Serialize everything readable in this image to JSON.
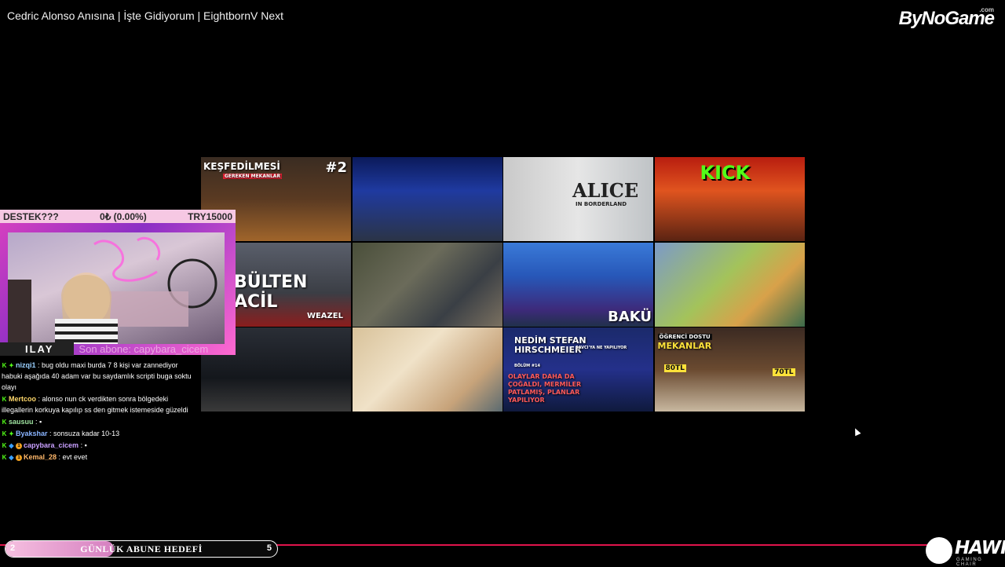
{
  "header": {
    "title": "Cedric Alonso Anısına | İşte Gidiyorum | EightbornV Next",
    "brand": "ByNoGame",
    "brand_sup": ".com"
  },
  "grid": {
    "thumbs": [
      {
        "caption": "KEŞFEDİLMESİ",
        "caption2": "#2",
        "subcap": "GEREKEN MEKANLAR"
      },
      {
        "caption": ""
      },
      {
        "caption": "ALICE",
        "subcap": "IN BORDERLAND"
      },
      {
        "caption": "KICK"
      },
      {
        "caption": "BÜLTEN ACİL",
        "subcap": "WEAZEL"
      },
      {
        "caption": ""
      },
      {
        "caption": "BAKÜ"
      },
      {
        "caption": ""
      },
      {
        "caption": ""
      },
      {
        "caption": ""
      },
      {
        "caption": "NEDİM STEFAN HIRSCHMEIER",
        "subcap": "SAVCI'YA NE YAPILIYOR",
        "subcap2": "BÖLÜM #14",
        "subcap3": "OLAYLAR DAHA DA ÇOĞALDI, MERMİLER PATLAMIŞ, PLANLAR YAPILIYOR"
      },
      {
        "caption": "ÖĞRENCİ DOSTU",
        "caption2": "MEKANLAR",
        "subcap": "80TL",
        "subcap2": "70TL"
      }
    ]
  },
  "overlay": {
    "goal_left": "DESTEK???",
    "goal_mid": "0₺ (0.00%)",
    "goal_right": "TRY15000",
    "streamer_name": "ILAY",
    "last_sub": "Son abone: capybara_cicem"
  },
  "chat": [
    {
      "user": "nizqi1",
      "color": "#9ad0ff",
      "badges": [
        "k",
        "star"
      ],
      "text": ": bug oldu maxi burda 7 8 kişi var zannediyor habuki aşağıda 40 adam var bu saydamlık scripti buga soktu olayı"
    },
    {
      "user": "Mertcoo",
      "color": "#ffd86b",
      "badges": [
        "k"
      ],
      "text": ": alonso nun ck verdikten sonra bölgedeki illegallerin korkuya kapılıp ss den gitmek istemeside güzeldi"
    },
    {
      "user": "sausuu",
      "color": "#9fe3a0",
      "badges": [
        "k"
      ],
      "text": ": ▪"
    },
    {
      "user": "Byakshar",
      "color": "#8ab4ff",
      "badges": [
        "k",
        "star"
      ],
      "text": ": sonsuza kadar 10-13"
    },
    {
      "user": "capybara_cicem",
      "color": "#c9a0ff",
      "badges": [
        "k",
        "gem",
        "o"
      ],
      "text": ": ▪"
    },
    {
      "user": "Kemal_28",
      "color": "#ffb86b",
      "badges": [
        "k",
        "gem",
        "o"
      ],
      "text": ": evt evet"
    }
  ],
  "bottom": {
    "goal_current": "2",
    "goal_title": "GÜNLÜK ABUNE HEDEFİ",
    "goal_target": "5",
    "goal_fraction": 0.4,
    "brand2": "HAWK",
    "brand2_sub": "GAMING CHAIR"
  }
}
